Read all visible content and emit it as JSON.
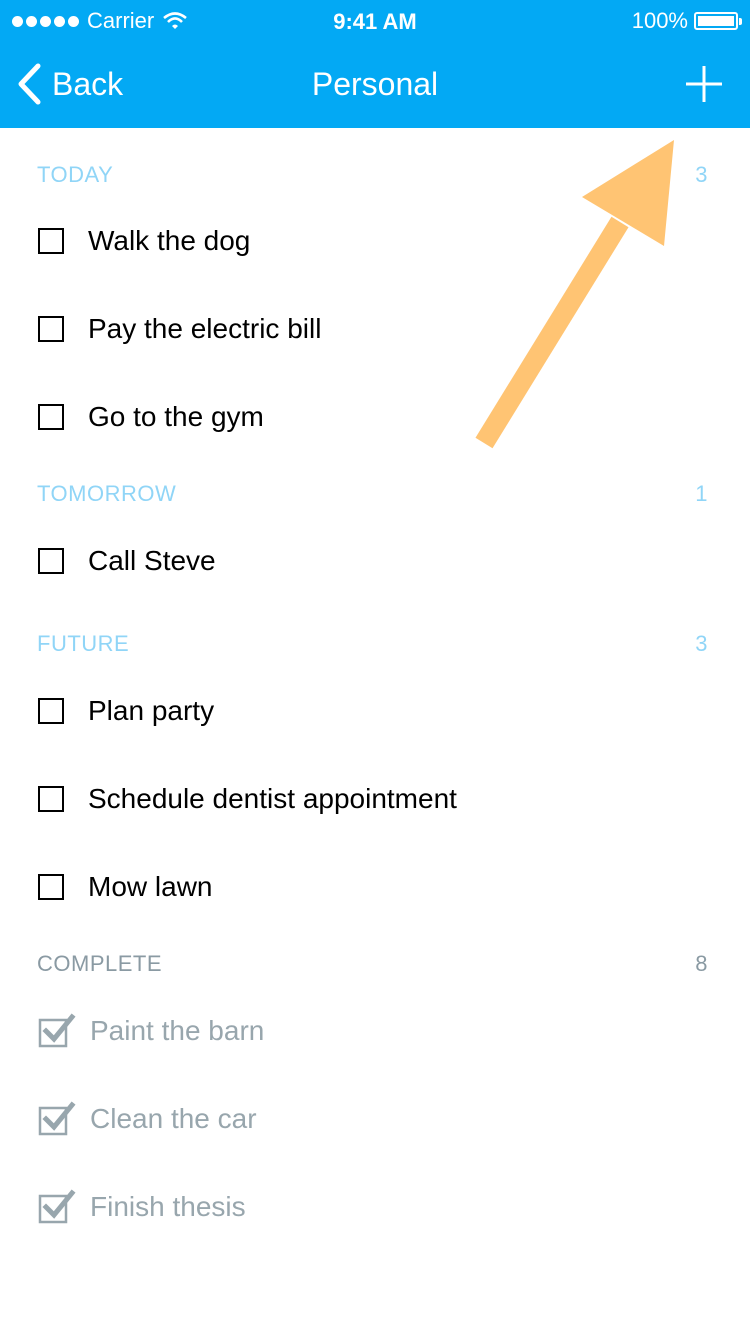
{
  "status_bar": {
    "carrier": "Carrier",
    "time": "9:41 AM",
    "battery": "100%"
  },
  "nav": {
    "back_label": "Back",
    "title": "Personal",
    "add_icon": "plus-icon"
  },
  "sections": [
    {
      "title": "TODAY",
      "count": "3",
      "color": "#90d5f7",
      "items": [
        "Walk the dog",
        "Pay the electric bill",
        "Go to the gym"
      ]
    },
    {
      "title": "TOMORROW",
      "count": "1",
      "color": "#90d5f7",
      "items": [
        "Call Steve"
      ]
    },
    {
      "title": "FUTURE",
      "count": "3",
      "color": "#90d5f7",
      "items": [
        "Plan party",
        "Schedule dentist appointment",
        "Mow lawn"
      ]
    },
    {
      "title": "COMPLETE",
      "count": "8",
      "color": "#8a9aa3",
      "items": [
        "Paint the barn",
        "Clean the car",
        "Finish thesis"
      ]
    }
  ],
  "colors": {
    "header": "#03a9f4",
    "annotation_arrow": "#ffc473",
    "completed_text": "#98a6ad"
  }
}
